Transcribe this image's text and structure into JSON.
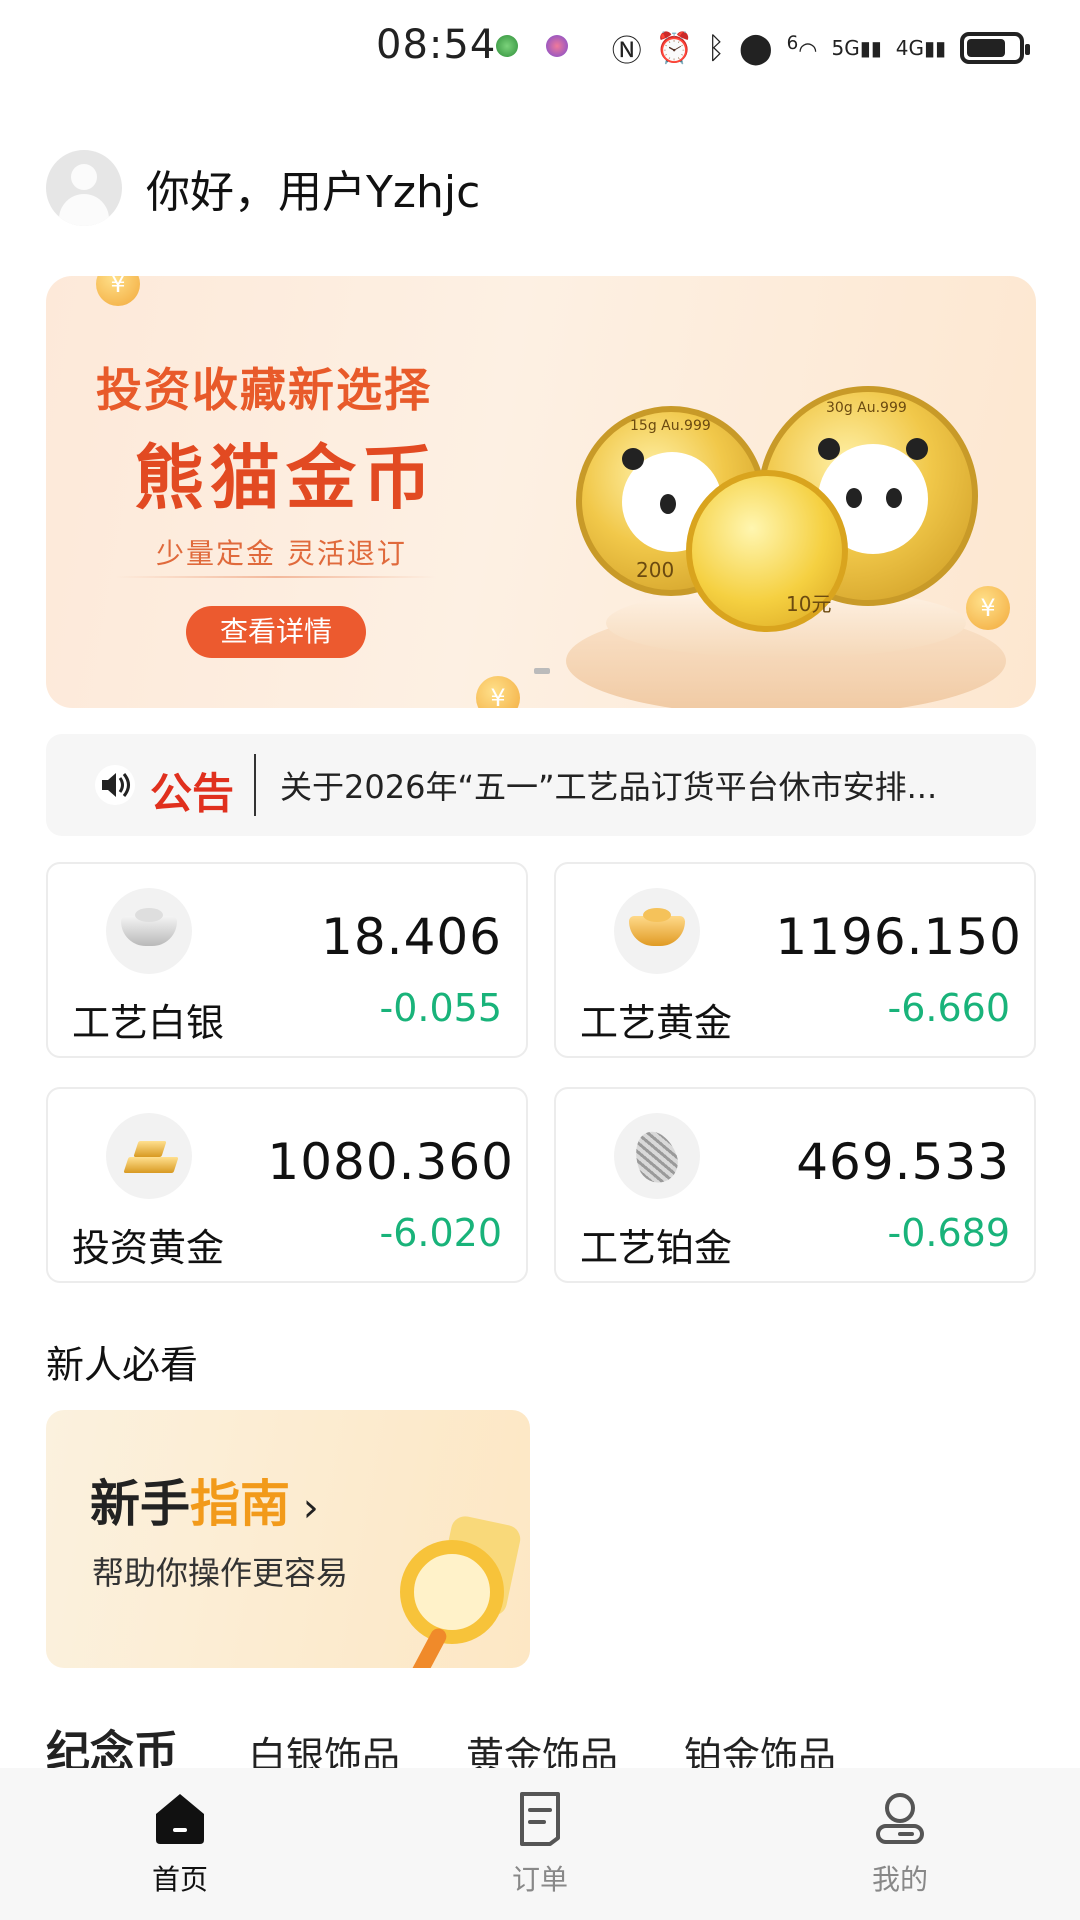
{
  "status_bar": {
    "time": "08:54",
    "network_5g": "5G",
    "network_4g": "4G",
    "wifi_badge": "6"
  },
  "header": {
    "greeting": "你好，用户Yzhjc"
  },
  "banner": {
    "headline": "投资收藏新选择",
    "title": "熊猫金币",
    "subtitle": "少量定金 灵活退订",
    "button": "查看详情",
    "coin_labels": [
      "15g Au.999",
      "30g Au.999",
      "200",
      "10元"
    ],
    "coin_symbol": "¥"
  },
  "notice": {
    "label": "公告",
    "text": "关于2026年“五一”工艺品订货平台休市安排..."
  },
  "prices": [
    {
      "name": "工艺白银",
      "price": "18.406",
      "change": "-0.055",
      "icon": "silver-ingot-icon"
    },
    {
      "name": "工艺黄金",
      "price": "1196.150",
      "change": "-6.660",
      "icon": "gold-ingot-icon"
    },
    {
      "name": "投资黄金",
      "price": "1080.360",
      "change": "-6.020",
      "icon": "gold-bars-icon"
    },
    {
      "name": "工艺铂金",
      "price": "469.533",
      "change": "-0.689",
      "icon": "platinum-leaf-icon"
    }
  ],
  "newbie": {
    "section_title": "新人必看",
    "card_title_part1": "新手",
    "card_title_part2": "指南",
    "card_subtitle": "帮助你操作更容易"
  },
  "categories": [
    "纪念币",
    "白银饰品",
    "黄金饰品",
    "铂金饰品"
  ],
  "nav": {
    "items": [
      "首页",
      "订单",
      "我的"
    ]
  },
  "colors": {
    "accent": "#ec5a2f",
    "down": "#19b37a",
    "notice_red": "#e0301e",
    "guide_orange": "#f29a1a"
  }
}
